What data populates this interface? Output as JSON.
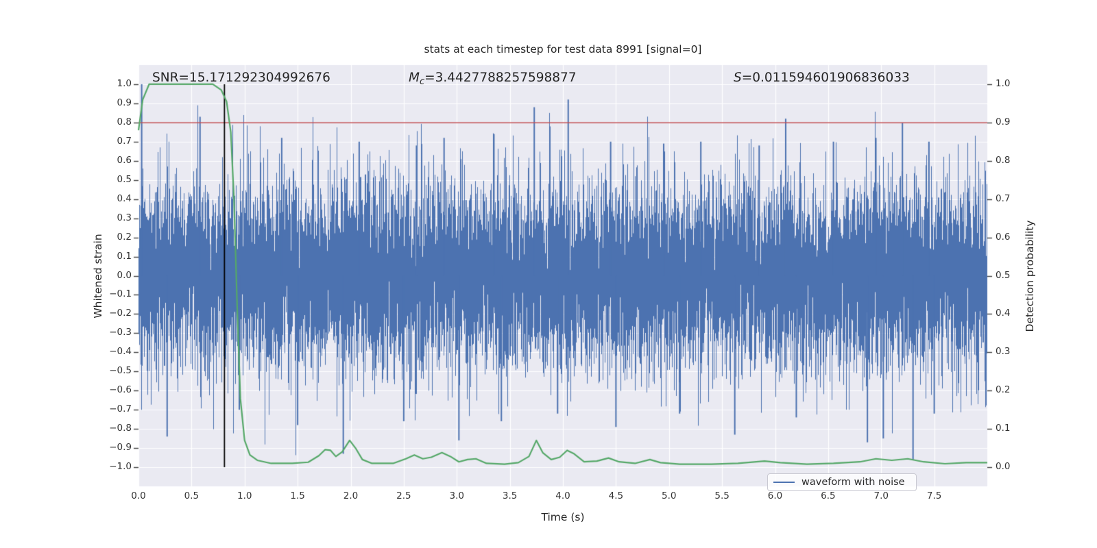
{
  "chart_data": {
    "type": "line",
    "title": "stats at each timestep for test data 8991 [signal=0]",
    "xlabel": "Time (s)",
    "ylabel_left": "Whitened strain",
    "ylabel_right": "Detection probability",
    "xlim": [
      0,
      8
    ],
    "ylim_left": [
      -1.1,
      1.1
    ],
    "ylim_right": [
      -0.05,
      1.05
    ],
    "grid": true,
    "background_color": "#eaeaf2",
    "grid_color": "#ffffff",
    "xticks": {
      "values": [
        0.0,
        0.5,
        1.0,
        1.5,
        2.0,
        2.5,
        3.0,
        3.5,
        4.0,
        4.5,
        5.0,
        5.5,
        6.0,
        6.5,
        7.0,
        7.5
      ],
      "labels": [
        "0.0",
        "0.5",
        "1.0",
        "1.5",
        "2.0",
        "2.5",
        "3.0",
        "3.5",
        "4.0",
        "4.5",
        "5.0",
        "5.5",
        "6.0",
        "6.5",
        "7.0",
        "7.5"
      ]
    },
    "yticks_left": {
      "values": [
        1.0,
        0.9,
        0.8,
        0.7,
        0.6,
        0.5,
        0.4,
        0.3,
        0.2,
        0.1,
        0.0,
        -0.1,
        -0.2,
        -0.3,
        -0.4,
        -0.5,
        -0.6,
        -0.7,
        -0.8,
        -0.9,
        -1.0
      ],
      "labels": [
        "1.0",
        "0.9",
        "0.8",
        "0.7",
        "0.6",
        "0.5",
        "0.4",
        "0.3",
        "0.2",
        "0.1",
        "0.0",
        "−0.1",
        "−0.2",
        "−0.3",
        "−0.4",
        "−0.5",
        "−0.6",
        "−0.7",
        "−0.8",
        "−0.9",
        "−1.0"
      ]
    },
    "yticks_right": {
      "values": [
        1.0,
        0.9,
        0.8,
        0.7,
        0.6,
        0.5,
        0.4,
        0.3,
        0.2,
        0.1,
        0.0
      ],
      "labels": [
        "1.0",
        "0.9",
        "0.8",
        "0.7",
        "0.6",
        "0.5",
        "0.4",
        "0.3",
        "0.2",
        "0.1",
        "0.0"
      ]
    },
    "annotations": {
      "snr": "SNR=15.171292304992676",
      "mc_var": "M",
      "mc_sub": "c",
      "mc_value": "=3.4427788257598877",
      "s_var": "S",
      "s_value": "=0.011594601906836033"
    },
    "hline": {
      "axis": "right",
      "y": 0.9,
      "color": "#c44e52"
    },
    "vline": {
      "x": 0.81,
      "y_from": -1.0,
      "y_to": 1.0,
      "color": "#000000"
    },
    "series": [
      {
        "name": "waveform with noise",
        "type": "noise_band",
        "axis": "left",
        "color": "#4c72b0",
        "generator": {
          "seed": 8991,
          "sigma": 0.24,
          "samples_per_column": 10,
          "clip": 1.02,
          "min_half_band": 0.03
        },
        "notable_spikes": [
          [
            0.03,
            1.0
          ],
          [
            0.27,
            -0.84
          ],
          [
            0.58,
            0.83
          ],
          [
            0.95,
            -0.7
          ],
          [
            1.35,
            0.72
          ],
          [
            1.5,
            -0.78
          ],
          [
            1.93,
            -0.93
          ],
          [
            2.08,
            0.7
          ],
          [
            2.5,
            -0.76
          ],
          [
            2.62,
            0.68
          ],
          [
            2.88,
            0.72
          ],
          [
            3.02,
            -0.86
          ],
          [
            3.35,
            0.74
          ],
          [
            3.42,
            -0.76
          ],
          [
            3.73,
            0.88
          ],
          [
            3.95,
            -0.72
          ],
          [
            4.05,
            0.92
          ],
          [
            4.45,
            0.7
          ],
          [
            4.5,
            -0.79
          ],
          [
            4.95,
            0.69
          ],
          [
            5.1,
            -0.72
          ],
          [
            5.3,
            0.7
          ],
          [
            5.62,
            -0.83
          ],
          [
            5.85,
            0.68
          ],
          [
            6.1,
            0.82
          ],
          [
            6.2,
            -0.74
          ],
          [
            6.55,
            0.7
          ],
          [
            6.87,
            -0.87
          ],
          [
            6.95,
            0.72
          ],
          [
            7.02,
            -0.85
          ],
          [
            7.2,
            0.8
          ],
          [
            7.3,
            -0.96
          ],
          [
            7.45,
            0.7
          ],
          [
            7.5,
            -0.72
          ]
        ]
      },
      {
        "name": "detection probability",
        "type": "line",
        "axis": "right",
        "color": "#55a868",
        "line_width": 2.2,
        "points": [
          [
            0.0,
            0.88
          ],
          [
            0.04,
            0.96
          ],
          [
            0.1,
            1.0
          ],
          [
            0.7,
            1.0
          ],
          [
            0.78,
            0.985
          ],
          [
            0.83,
            0.955
          ],
          [
            0.87,
            0.875
          ],
          [
            0.9,
            0.7
          ],
          [
            0.93,
            0.42
          ],
          [
            0.96,
            0.18
          ],
          [
            1.0,
            0.07
          ],
          [
            1.05,
            0.032
          ],
          [
            1.12,
            0.018
          ],
          [
            1.25,
            0.01
          ],
          [
            1.45,
            0.01
          ],
          [
            1.6,
            0.013
          ],
          [
            1.7,
            0.03
          ],
          [
            1.76,
            0.046
          ],
          [
            1.81,
            0.044
          ],
          [
            1.86,
            0.028
          ],
          [
            1.92,
            0.04
          ],
          [
            1.99,
            0.07
          ],
          [
            2.05,
            0.048
          ],
          [
            2.11,
            0.02
          ],
          [
            2.2,
            0.01
          ],
          [
            2.4,
            0.01
          ],
          [
            2.52,
            0.022
          ],
          [
            2.6,
            0.032
          ],
          [
            2.68,
            0.022
          ],
          [
            2.76,
            0.026
          ],
          [
            2.86,
            0.038
          ],
          [
            2.94,
            0.028
          ],
          [
            3.02,
            0.014
          ],
          [
            3.1,
            0.02
          ],
          [
            3.18,
            0.022
          ],
          [
            3.28,
            0.01
          ],
          [
            3.45,
            0.008
          ],
          [
            3.58,
            0.012
          ],
          [
            3.68,
            0.028
          ],
          [
            3.75,
            0.07
          ],
          [
            3.81,
            0.038
          ],
          [
            3.89,
            0.02
          ],
          [
            3.97,
            0.026
          ],
          [
            4.04,
            0.044
          ],
          [
            4.1,
            0.036
          ],
          [
            4.2,
            0.014
          ],
          [
            4.32,
            0.016
          ],
          [
            4.43,
            0.024
          ],
          [
            4.53,
            0.014
          ],
          [
            4.68,
            0.01
          ],
          [
            4.82,
            0.02
          ],
          [
            4.92,
            0.012
          ],
          [
            5.1,
            0.008
          ],
          [
            5.4,
            0.008
          ],
          [
            5.65,
            0.01
          ],
          [
            5.9,
            0.016
          ],
          [
            6.05,
            0.012
          ],
          [
            6.3,
            0.008
          ],
          [
            6.55,
            0.01
          ],
          [
            6.8,
            0.014
          ],
          [
            6.95,
            0.022
          ],
          [
            7.1,
            0.018
          ],
          [
            7.25,
            0.022
          ],
          [
            7.4,
            0.014
          ],
          [
            7.6,
            0.009
          ],
          [
            7.8,
            0.012
          ],
          [
            8.0,
            0.012
          ]
        ]
      }
    ],
    "legend": {
      "loc": "lower right",
      "entries": [
        {
          "label": "waveform with noise",
          "color": "#4c72b0"
        }
      ]
    }
  }
}
